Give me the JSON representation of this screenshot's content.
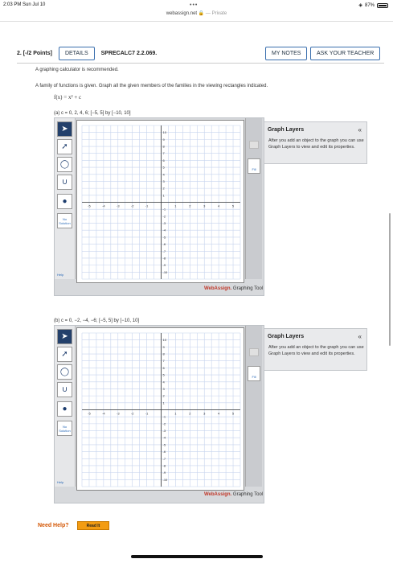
{
  "status_bar": {
    "time": "2:03 PM  Sun Jul 10",
    "battery": "87%",
    "battery_level": 0.87
  },
  "browser": {
    "dots": "•••",
    "url": "webassign.net",
    "private_label": "— Private"
  },
  "question": {
    "number": "2.  [-/2 Points]",
    "details_label": "DETAILS",
    "code": "SPRECALC7 2.2.069.",
    "my_notes_label": "MY NOTES",
    "ask_teacher_label": "ASK YOUR TEACHER",
    "calc_note": "A graphing calculator is recommended.",
    "instruction": "A family of functions is given. Graph all the given members of the families in the viewing rectangles indicated.",
    "function": "f(x) = x² + c"
  },
  "parts": [
    {
      "label": "(a)    c = 0, 2, 4, 6; [−5, 5] by [−10, 10]",
      "x_ticks": [
        "-5",
        "-4",
        "-3",
        "-2",
        "-1",
        "1",
        "2",
        "3",
        "4",
        "5"
      ],
      "y_ticks": [
        "10",
        "9",
        "8",
        "7",
        "6",
        "5",
        "4",
        "3",
        "2",
        "1",
        "-1",
        "-2",
        "-3",
        "-4",
        "-5",
        "-6",
        "-7",
        "-8",
        "-9",
        "-10"
      ]
    },
    {
      "label": "(b)    c = 0, −2, −4, −6; [−5, 5] by [−10, 10]",
      "x_ticks": [
        "-5",
        "-4",
        "-3",
        "-2",
        "-1",
        "1",
        "2",
        "3",
        "4",
        "5"
      ],
      "y_ticks": [
        "10",
        "9",
        "8",
        "7",
        "6",
        "5",
        "4",
        "3",
        "2",
        "1",
        "-1",
        "-2",
        "-3",
        "-4",
        "-5",
        "-6",
        "-7",
        "-8",
        "-9",
        "-10"
      ]
    }
  ],
  "tool": {
    "no_solution": "No Solution",
    "help": "Help",
    "fill_label": "Fill",
    "brand": "WebAssign.",
    "brand_suffix": " Graphing Tool",
    "layers_title": "Graph Layers",
    "layers_collapse": "«",
    "layers_desc": "After you add an object to the graph you can use Graph Layers to view and edit its properties."
  },
  "footer": {
    "need_help": "Need Help?",
    "read_it": "Read It"
  }
}
